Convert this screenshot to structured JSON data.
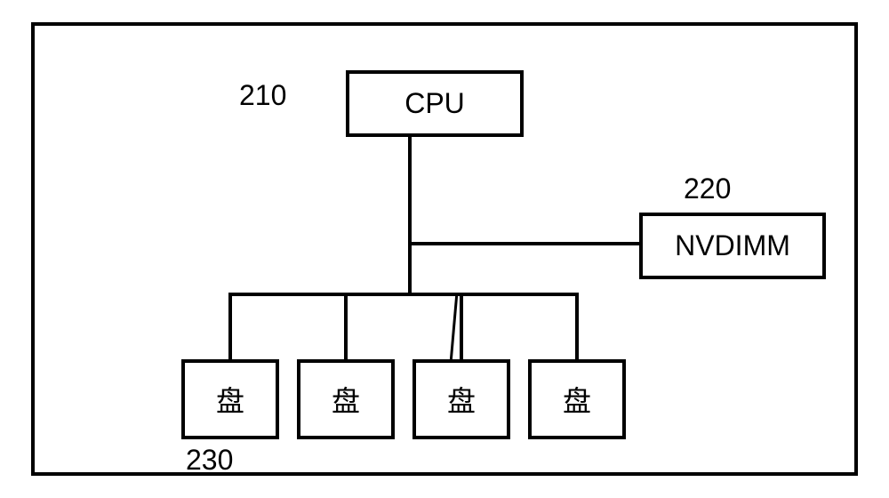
{
  "labels": {
    "cpu_ref": "210",
    "nvdimm_ref": "220",
    "disk_ref": "230"
  },
  "nodes": {
    "cpu": "CPU",
    "nvdimm": "NVDIMM",
    "disk": "盘"
  },
  "chart_data": {
    "type": "diagram",
    "title": "",
    "nodes": [
      {
        "id": "cpu",
        "label": "CPU",
        "ref": "210"
      },
      {
        "id": "nvdimm",
        "label": "NVDIMM",
        "ref": "220"
      },
      {
        "id": "disk1",
        "label": "盘",
        "ref": "230"
      },
      {
        "id": "disk2",
        "label": "盘"
      },
      {
        "id": "disk3",
        "label": "盘"
      },
      {
        "id": "disk4",
        "label": "盘"
      }
    ],
    "edges": [
      {
        "from": "cpu",
        "to": "nvdimm"
      },
      {
        "from": "cpu",
        "to": "disk1"
      },
      {
        "from": "cpu",
        "to": "disk2"
      },
      {
        "from": "cpu",
        "to": "disk3"
      },
      {
        "from": "cpu",
        "to": "disk4"
      }
    ]
  }
}
